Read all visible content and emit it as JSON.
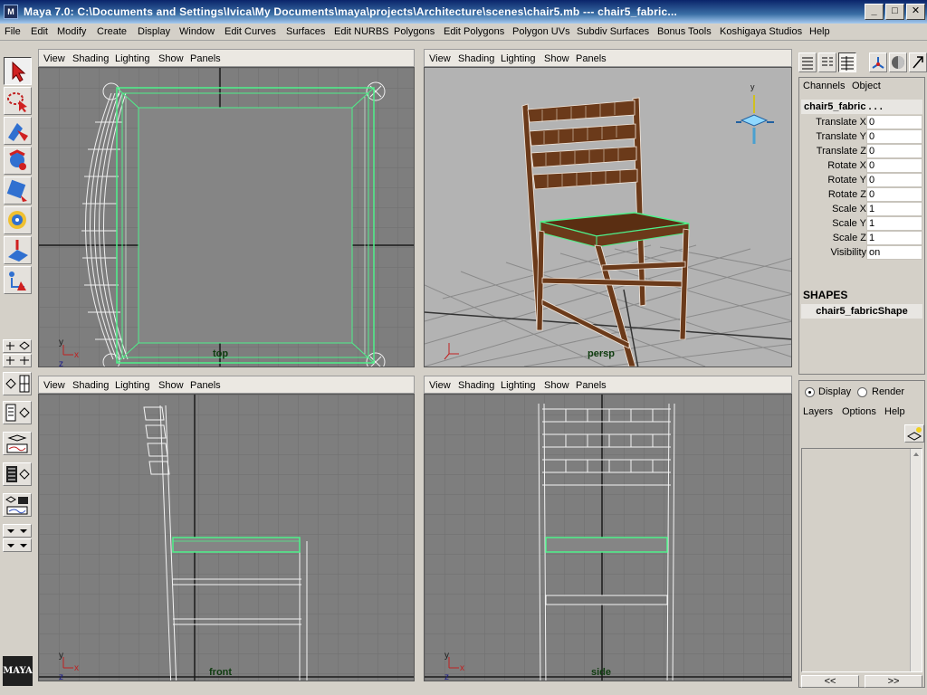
{
  "window": {
    "title": "Maya 7.0: C:\\Documents and Settings\\Ivica\\My Documents\\maya\\projects\\Architecture\\scenes\\chair5.mb    ---    chair5_fabric...",
    "icon_text": "M",
    "buttons": {
      "minimize": "_",
      "maximize": "□",
      "close": "✕"
    }
  },
  "menubar": [
    "File",
    "Edit",
    "Modify",
    "Create",
    "Display",
    "Window",
    "Edit Curves",
    "Surfaces",
    "Edit NURBS",
    "Polygons",
    "Edit Polygons",
    "Polygon UVs",
    "Subdiv Surfaces",
    "Bonus Tools",
    "Koshigaya Studios",
    "Help"
  ],
  "viewport_menu": [
    "View",
    "Shading",
    "Lighting",
    "Show",
    "Panels"
  ],
  "viewports": {
    "top": {
      "camera": "top"
    },
    "persp": {
      "camera": "persp"
    },
    "front": {
      "camera": "front"
    },
    "side": {
      "camera": "side"
    }
  },
  "axis_labels": {
    "x": "x",
    "y": "y",
    "z": "z"
  },
  "toolbox": {
    "logo_text": "MAYA"
  },
  "channel_box": {
    "tabs": [
      "Channels",
      "Object"
    ],
    "object_name": "chair5_fabric  . . .",
    "attributes": [
      {
        "label": "Translate X",
        "value": "0"
      },
      {
        "label": "Translate Y",
        "value": "0"
      },
      {
        "label": "Translate Z",
        "value": "0"
      },
      {
        "label": "Rotate X",
        "value": "0"
      },
      {
        "label": "Rotate Y",
        "value": "0"
      },
      {
        "label": "Rotate Z",
        "value": "0"
      },
      {
        "label": "Scale X",
        "value": "1"
      },
      {
        "label": "Scale Y",
        "value": "1"
      },
      {
        "label": "Scale Z",
        "value": "1"
      },
      {
        "label": "Visibility",
        "value": "on"
      }
    ],
    "shapes_header": "SHAPES",
    "shape_name": "chair5_fabricShape"
  },
  "layer_editor": {
    "modes": [
      {
        "label": "Display",
        "selected": true
      },
      {
        "label": "Render",
        "selected": false
      }
    ],
    "menu": [
      "Layers",
      "Options",
      "Help"
    ],
    "nav": [
      "<<",
      ">>"
    ]
  },
  "colors": {
    "viewport_bg": "#7b7b7b",
    "persp_bg": "#b3b3b3",
    "grid": "#6d6d6d",
    "selection": "#4ff08a",
    "wood": "#5a2e12"
  }
}
